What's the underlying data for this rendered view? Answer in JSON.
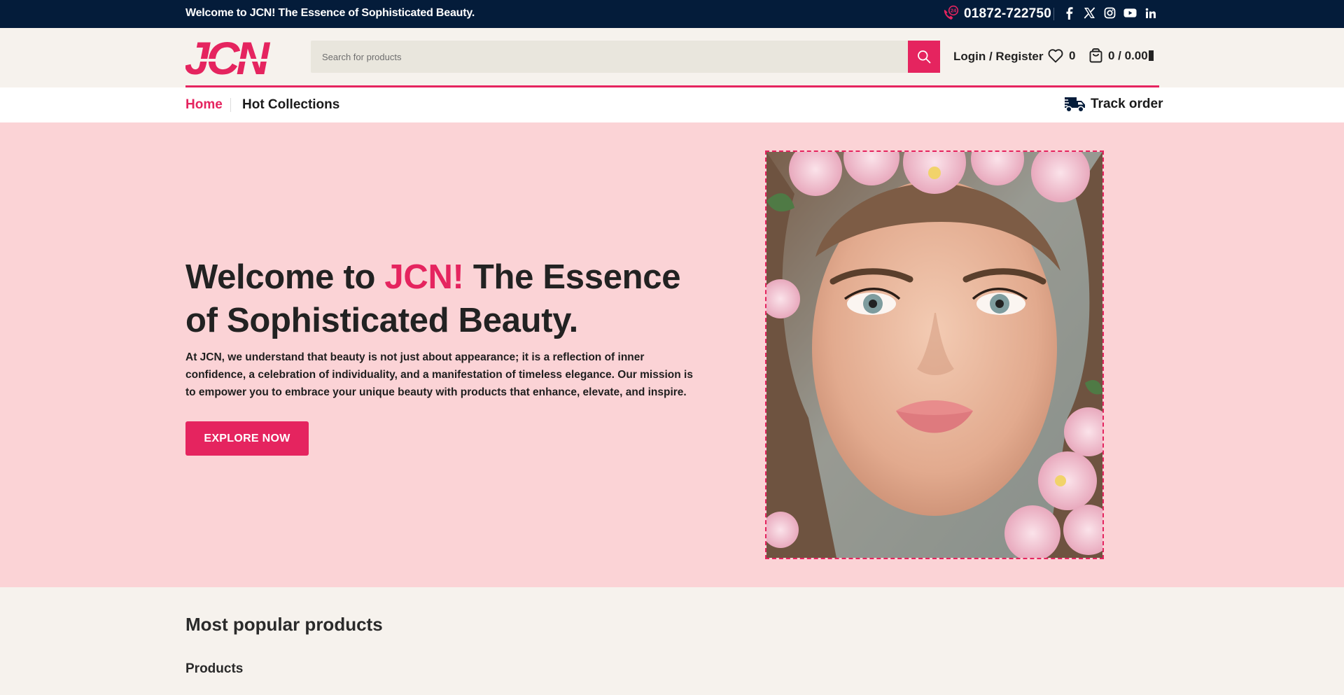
{
  "topbar": {
    "welcome": "Welcome to JCN! The Essence of Sophisticated Beauty.",
    "phone_badge": "24",
    "phone": "01872-722750",
    "socials": [
      "facebook-icon",
      "x-icon",
      "instagram-icon",
      "youtube-icon",
      "linkedin-icon"
    ]
  },
  "header": {
    "logo_text": "JCN",
    "search_placeholder": "Search for products",
    "login_label": "Login / Register",
    "wishlist_count": "0",
    "cart_label": "0 / 0.00"
  },
  "nav": {
    "home": "Home",
    "hot_collections": "Hot Collections",
    "track_order": "Track order"
  },
  "hero": {
    "title_before": "Welcome to ",
    "title_brand": "JCN!",
    "title_after": " The Essence of Sophisticated Beauty.",
    "description": "At JCN, we understand that beauty is not just about appearance; it is a reflection of inner confidence, a celebration of individuality, and a manifestation of timeless elegance. Our mission is to empower you to embrace your unique beauty with products that enhance, elevate, and inspire.",
    "cta": "EXPLORE NOW"
  },
  "sections": {
    "popular_heading": "Most popular products",
    "products_heading": "Products"
  },
  "colors": {
    "accent": "#e5245f",
    "navy": "#041c3a",
    "hero_bg": "#fbd3d6",
    "page_bg": "#f6f2ed"
  }
}
